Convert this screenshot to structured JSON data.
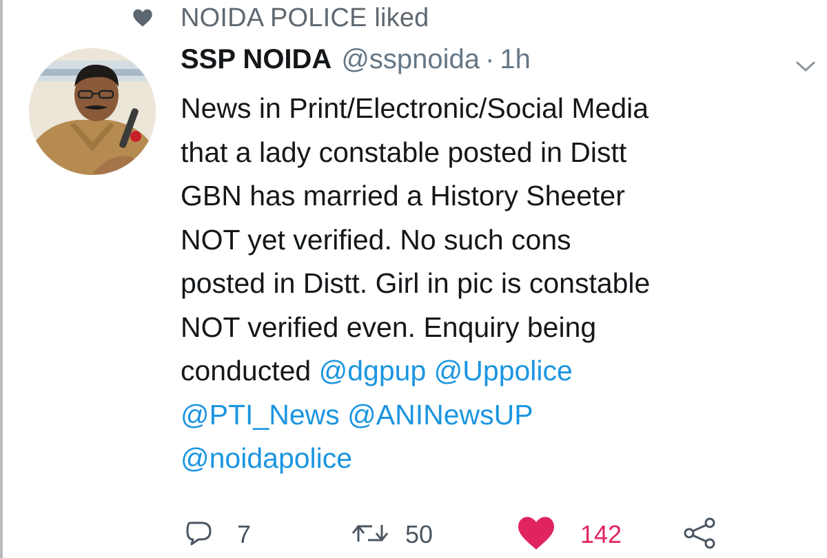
{
  "social_context": {
    "text": "NOIDA POLICE liked",
    "icon": "heart-icon"
  },
  "tweet": {
    "author_name": "SSP NOIDA",
    "handle": "@sspnoida",
    "separator": "·",
    "time": "1h",
    "caret_icon": "chevron-down-icon",
    "body_lines": [
      "News in Print/Electronic/Social Media",
      "that a lady constable posted in Distt",
      "GBN has married a History Sheeter",
      "NOT yet verified. No such cons",
      "posted in Distt. Girl in pic is constable",
      "NOT verified even. Enquiry being"
    ],
    "last_line_prefix": "conducted",
    "mentions": [
      "@dgpup",
      "@Uppolice",
      "@PTI_News",
      "@ANINewsUP",
      "@noidapolice"
    ]
  },
  "actions": {
    "reply_count": "7",
    "retweet_count": "50",
    "like_count": "142"
  },
  "colors": {
    "mention": "#1b95e0",
    "like": "#e0245e",
    "secondary_text": "#657786"
  }
}
